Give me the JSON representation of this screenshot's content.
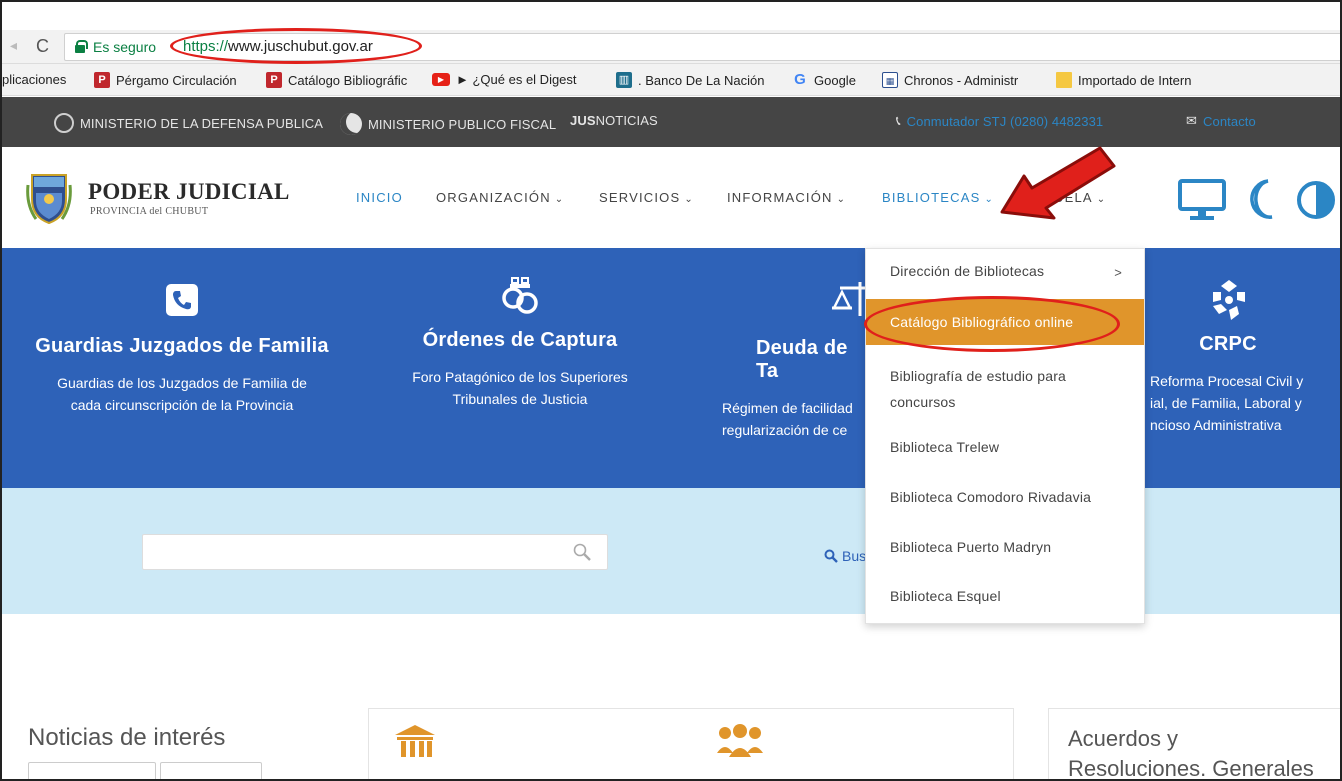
{
  "browser": {
    "secure_label": "Es seguro",
    "url_scheme": "https://",
    "url_host": "www.juschubut.gov.ar"
  },
  "bookmarks": [
    {
      "label": "plicaciones",
      "icon": "none"
    },
    {
      "label": "Pérgamo Circulación",
      "icon": "pergamo-icon"
    },
    {
      "label": "Catálogo Bibliográfic",
      "icon": "pergamo-icon"
    },
    {
      "label": "► ¿Qué es el Digest",
      "icon": "youtube-icon"
    },
    {
      "label": ". Banco De La Nación",
      "icon": "bank-icon"
    },
    {
      "label": "Google",
      "icon": "google-icon"
    },
    {
      "label": "Chronos - Administr",
      "icon": "calendar-icon"
    },
    {
      "label": "Importado de Intern",
      "icon": "folder-icon"
    }
  ],
  "topbar": {
    "defensa": "MINISTERIO DE LA DEFENSA PUBLICA",
    "fiscal": "MINISTERIO PUBLICO FISCAL",
    "jus_bold": "JUS",
    "jus_rest": "NOTICIAS",
    "conmutador": "Conmutador STJ (0280) 4482331",
    "contacto": "Contacto"
  },
  "brand": {
    "title": "PODER JUDICIAL",
    "subtitle": "PROVINCIA del CHUBUT"
  },
  "nav": {
    "inicio": "INICIO",
    "organizacion": "ORGANIZACIÓN",
    "servicios": "SERVICIOS",
    "informacion": "INFORMACIÓN",
    "bibliotecas": "BIBLIOTECAS",
    "escuela_partial": "UELA"
  },
  "cards": [
    {
      "title": "Guardias Juzgados de Familia",
      "desc_1": "Guardias de los Juzgados de Familia de",
      "desc_2": "cada circunscripción de la Provincia"
    },
    {
      "title": "Órdenes de Captura",
      "desc_1": "Foro Patagónico de los Superiores",
      "desc_2": "Tribunales de Justicia"
    },
    {
      "title": "Deuda de Ta",
      "desc_1": "Régimen de facilidad",
      "desc_2": "regularización de ce"
    },
    {
      "title": "CRPC",
      "desc_1": "Reforma Procesal Civil y",
      "desc_2": "ial, de Familia, Laboral y",
      "desc_3": "ncioso Administrativa"
    }
  ],
  "search": {
    "value": "",
    "link_partial": "Bus"
  },
  "dropdown": {
    "items": [
      "Dirección de Bibliotecas",
      "Catálogo Bibliográfico online",
      "Bibliografía de estudio para",
      "concursos",
      "Biblioteca Trelew",
      "Biblioteca Comodoro Rivadavia",
      "Biblioteca Puerto Madryn",
      "Biblioteca Esquel"
    ],
    "submenu_arrow": ">"
  },
  "lower": {
    "news_title": "Noticias de interés",
    "acuerdos_1": "Acuerdos y",
    "acuerdos_2": "Resoluciones. Generales"
  },
  "colors": {
    "primary_blue": "#2e62b8",
    "nav_active": "#2b86c5",
    "highlight_orange": "#e0952b",
    "annotation_red": "#e0201b"
  }
}
